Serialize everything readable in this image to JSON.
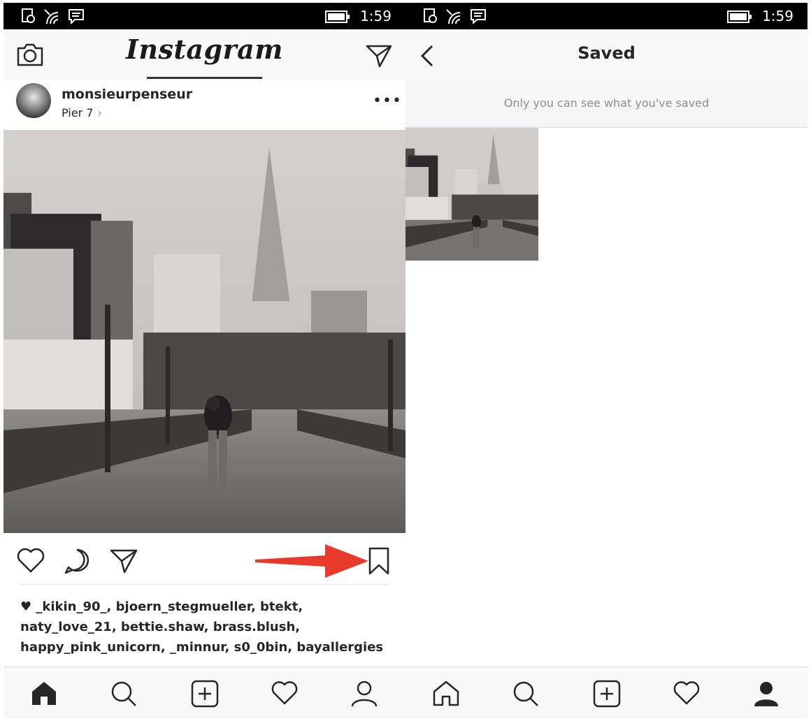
{
  "status_bar": {
    "time": "1:59"
  },
  "left": {
    "logo": "Instagram",
    "post": {
      "username": "monsieurpenseur",
      "location": "Pier 7",
      "location_chevron": "›",
      "more": "•••",
      "photo_icon": "photo-placeholder"
    },
    "likes_text": "♥ _kikin_90_, bjoern_stegmueller, btekt, naty_love_21, bettie.shaw, brass.blush, happy_pink_unicorn, _minnur, s0_0bin, bayallergies"
  },
  "right": {
    "title": "Saved",
    "info": "Only you can see what you've saved"
  },
  "bottom_nav": {
    "items": [
      "home-icon",
      "search-icon",
      "add-icon",
      "heart-icon",
      "profile-icon"
    ]
  }
}
